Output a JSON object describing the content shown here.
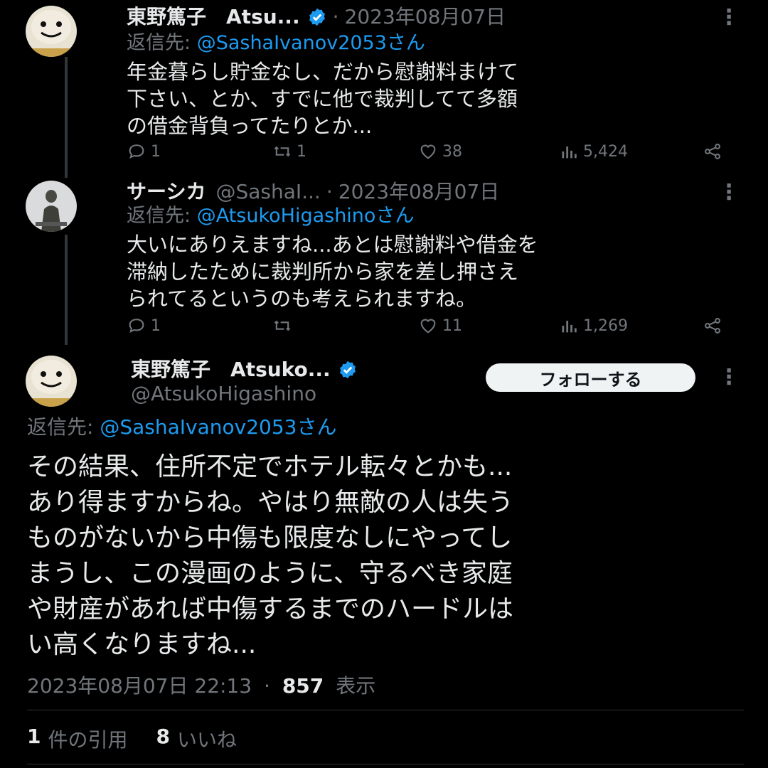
{
  "colors": {
    "background": "#000000",
    "text": "#e7e9ea",
    "muted": "#71767b",
    "link": "#1d9bf0",
    "verified": "#1d9bf0"
  },
  "tweets": [
    {
      "name": "東野篤子",
      "handle_truncated": "Atsu...",
      "verified": true,
      "separator": "·",
      "date": "2023年08月07日",
      "reply_prefix": "返信先: ",
      "reply_mention": "@SashaIvanov2053さん",
      "text": "年金暮らし貯金なし、だから慰謝料まけて\n下さい、とか、すでに他で裁判してて多額\nの借金背負ってたりとか...",
      "replies": "1",
      "retweets": "1",
      "likes": "38",
      "views": "5,424",
      "icons": [
        "reply-icon",
        "retweet-icon",
        "like-icon",
        "views-icon",
        "share-icon"
      ]
    },
    {
      "name": "サーシカ",
      "handle_truncated": "@SashaI...",
      "separator": "·",
      "date": "2023年08月07日",
      "reply_prefix": "返信先: ",
      "reply_mention": "@AtsukoHigashinoさん",
      "text": "大いにありえますね...あとは慰謝料や借金を\n滞納したために裁判所から家を差し押さえ\nられてるというのも考えられますね。",
      "replies": "1",
      "retweets": "",
      "likes": "11",
      "views": "1,269"
    }
  ],
  "main": {
    "name": "東野篤子",
    "name_truncated": "Atsuko...",
    "handle": "@AtsukoHigashino",
    "verified": true,
    "follow_label": "フォローする",
    "reply_prefix": "返信先: ",
    "reply_mention": "@SashaIvanov2053さん",
    "text": "その結果、住所不定でホテル転々とかも...\nあり得ますからね。やはり無敵の人は失う\nものがないから中傷も限度なしにやってし\nまうし、この漫画のように、守るべき家庭\nや財産があれば中傷するまでのハードルは\nい高くなりますね...",
    "timestamp": "2023年08月07日 22:13",
    "separator": "·",
    "views_count": "857",
    "views_label": "表示",
    "quotes_count": "1",
    "quotes_label": "件の引用",
    "likes_count": "8",
    "likes_label": "いいね"
  }
}
